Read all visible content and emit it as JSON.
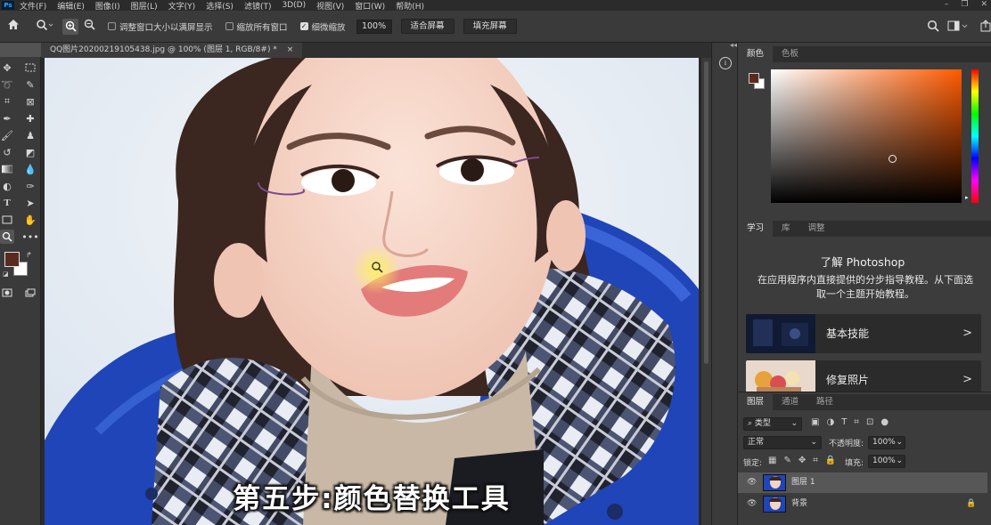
{
  "menu": {
    "app_icon": "Ps",
    "items": [
      "文件(F)",
      "编辑(E)",
      "图像(I)",
      "图层(L)",
      "文字(Y)",
      "选择(S)",
      "滤镜(T)",
      "3D(D)",
      "视图(V)",
      "窗口(W)",
      "帮助(H)"
    ]
  },
  "options": {
    "resize_windows": "调整窗口大小以满屏显示",
    "zoom_all": "缩放所有窗口",
    "scrubby_zoom": "细微缩放",
    "zoom_level": "100%",
    "fit_screen": "适合屏幕",
    "fill_screen": "填充屏幕"
  },
  "document": {
    "tab_title": "QQ图片20200219105438.jpg @ 100% (图层 1, RGB/8#) *",
    "close": "×"
  },
  "colors": {
    "foreground": "#5a2a1e",
    "background": "#ffffff",
    "accent": "#31a8ff"
  },
  "canvas": {
    "caption": "第五步:颜色替换工具"
  },
  "color_panel": {
    "tabs": [
      "颜色",
      "色板"
    ],
    "active_tab": 0
  },
  "learn_panel": {
    "tabs": [
      "学习",
      "库",
      "调整"
    ],
    "title": "了解 Photoshop",
    "description": "在应用程序内直接提供的分步指导教程。从下面选取一个主题开始教程。",
    "topics": [
      {
        "label": "基本技能",
        "arrow": ">"
      },
      {
        "label": "修复照片",
        "arrow": ">"
      }
    ]
  },
  "layers_panel": {
    "tabs": [
      "图层",
      "通道",
      "路径"
    ],
    "filter_kind": "类型",
    "blend_mode": "正常",
    "opacity_label": "不透明度:",
    "opacity_value": "100%",
    "lock_label": "锁定:",
    "fill_label": "填充:",
    "fill_value": "100%",
    "layers": [
      {
        "name": "图层 1",
        "selected": true
      },
      {
        "name": "背景",
        "locked": true
      }
    ]
  }
}
